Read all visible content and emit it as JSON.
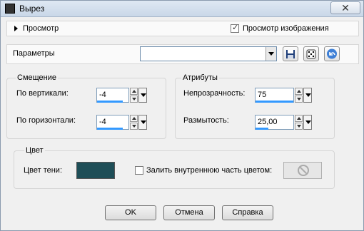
{
  "window": {
    "title": "Вырез",
    "close_symbol": "✕"
  },
  "preview": {
    "toggle_label": "Просмотр",
    "image_preview_label": "Просмотр изображения",
    "image_preview_checked": true
  },
  "params": {
    "label": "Параметры",
    "preset_value": ""
  },
  "offset": {
    "title": "Смещение",
    "vertical_label": "По вертикали:",
    "vertical_value": "-4",
    "horizontal_label": "По горизонтали:",
    "horizontal_value": "-4"
  },
  "attributes": {
    "title": "Атрибуты",
    "opacity_label": "Непрозрачность:",
    "opacity_value": "75",
    "blur_label": "Размытость:",
    "blur_value": "25,00"
  },
  "color": {
    "title": "Цвет",
    "shadow_label": "Цвет тени:",
    "shadow_color": "#1e4e57",
    "fill_inner_label": "Залить внутреннюю часть цветом:",
    "fill_inner_checked": false
  },
  "buttons": {
    "ok": "OK",
    "cancel": "Отмена",
    "help": "Справка"
  }
}
